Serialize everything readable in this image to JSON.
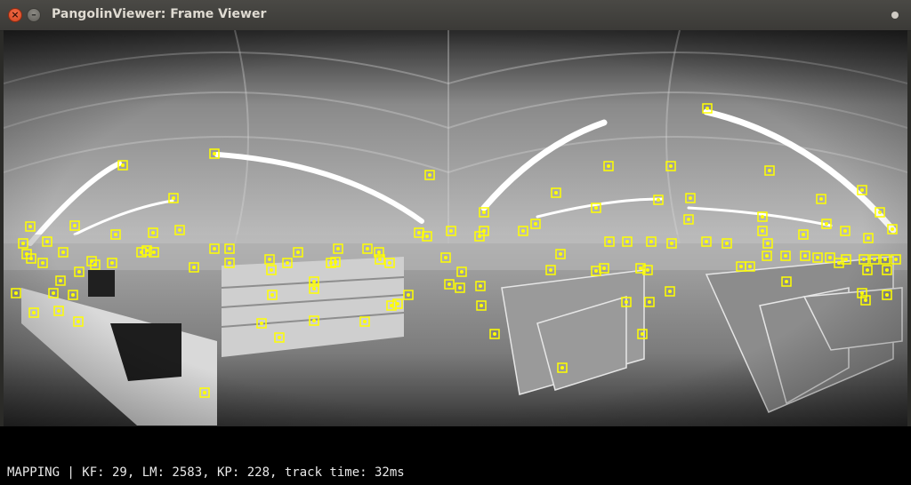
{
  "window": {
    "title": "PangolinViewer: Frame Viewer",
    "close_glyph": "×",
    "minimize_glyph": "–"
  },
  "status": {
    "text": "MAPPING | KF: 29, LM: 2583, KP: 228, track time: 32ms"
  },
  "frame": {
    "image": "equirectangular grayscale 360° camera frame of a store interior with shelves",
    "marker_color": "#ffff00",
    "keypoint_count_shown": "KP: 228"
  }
}
